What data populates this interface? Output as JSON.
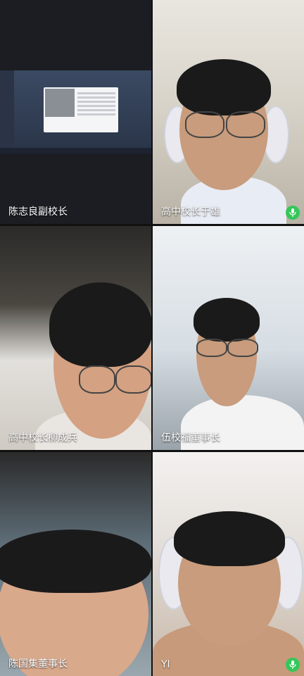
{
  "participants": [
    {
      "name": "陈志良副校长",
      "mic_active": false
    },
    {
      "name": "高中校长于雄",
      "mic_active": true
    },
    {
      "name": "高中校长柳成兵",
      "mic_active": false
    },
    {
      "name": "伍校福董事长",
      "mic_active": false
    },
    {
      "name": "陈国集董事长",
      "mic_active": false
    },
    {
      "name": "YI",
      "mic_active": true
    }
  ],
  "icons": {
    "mic": "microphone-icon"
  },
  "colors": {
    "mic_active": "#34c759",
    "name_text": "#ffffff",
    "background": "#111111"
  }
}
